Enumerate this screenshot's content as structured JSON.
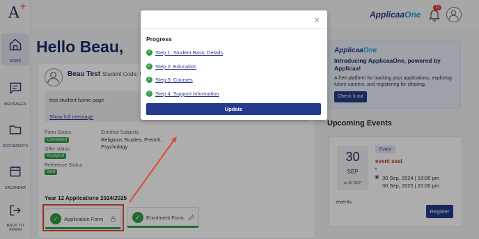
{
  "app": {
    "logo": "A",
    "logo_mark": "+",
    "brand": "Applicaa",
    "brand_suffix": "One"
  },
  "sidebar": {
    "items": [
      {
        "label": "HOME",
        "icon": "home-icon"
      },
      {
        "label": "MESSAGES",
        "icon": "message-icon"
      },
      {
        "label": "DOCUMENTS",
        "icon": "folder-icon"
      },
      {
        "label": "CALENDAR",
        "icon": "calendar-icon"
      },
      {
        "label": "BACK TO",
        "label2": "ADMIN",
        "icon": "logout-icon"
      }
    ]
  },
  "header": {
    "notification_count": "11"
  },
  "main": {
    "greeting": "Hello Beau,",
    "student_name": "Beau Test",
    "student_code_label": "Student Code: U",
    "message_text": "test student home page",
    "show_full_message": "Show full message",
    "form_status_label": "Form Status",
    "form_status_value": "Completed",
    "offer_status_label": "Offer status",
    "offer_status_value": "Accepted",
    "reference_status_label": "Reference Status",
    "reference_status_value": "Sent",
    "enrolled_subjects_label": "Enrolled Subjects",
    "enrolled_subjects_value": "Religious Studies, French, Psychology",
    "applications_heading": "Year 12 Applications 2024/2025",
    "application_form_label": "Application Form",
    "enrolment_form_label": "Enrolment Form"
  },
  "promo": {
    "logo": "Applicaa",
    "logo_suffix": "One",
    "title": "Introducing ApplicaaOne, powered by Applicaa!",
    "description": "A free platform for tracking your applications, exploring future careers, and registering for clearing.",
    "button": "Check it out"
  },
  "events": {
    "title": "Upcoming Events",
    "day": "30",
    "month": "SEP",
    "to_date": "to 30 SEP",
    "tag": "Event",
    "name": "event seal",
    "start": "30 Sep, 2024 | 19:00 pm",
    "end": "30 Sep, 2025 | 22:00 pm",
    "description": "events",
    "register_button": "Register"
  },
  "modal": {
    "title": "Progress",
    "steps": [
      {
        "label": "Step 1: Student Basic Details"
      },
      {
        "label": "Step 2: Education"
      },
      {
        "label": "Step 3: Courses"
      },
      {
        "label": "Step 4: Support Information"
      }
    ],
    "update_button": "Update",
    "close": "×"
  },
  "colors": {
    "accent": "#233b8a",
    "success": "#2f9e44",
    "annotation": "#e0473a"
  }
}
